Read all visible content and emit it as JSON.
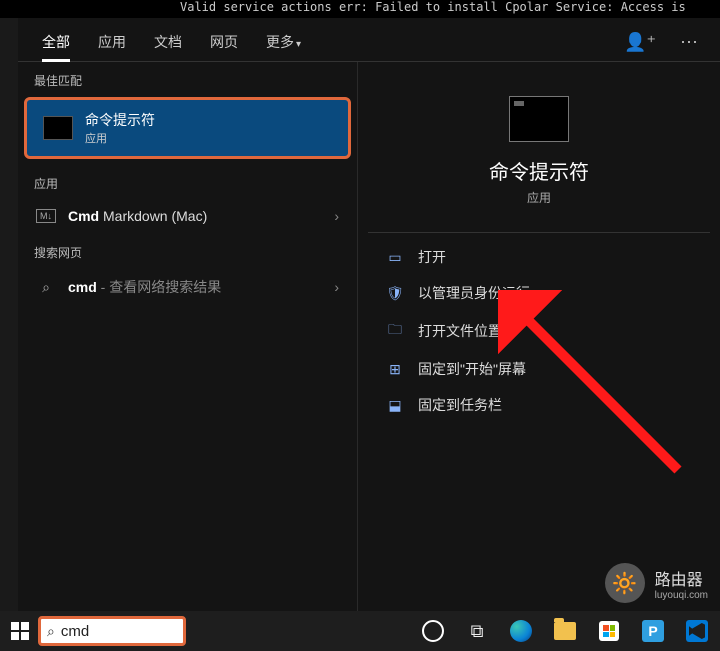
{
  "top_text": "Valid service actions err: Failed to install Cpolar Service: Access is ",
  "tabs": {
    "all": "全部",
    "apps": "应用",
    "docs": "文档",
    "web": "网页",
    "more": "更多"
  },
  "left": {
    "best_match_label": "最佳匹配",
    "best_match": {
      "title": "命令提示符",
      "sub": "应用"
    },
    "apps_label": "应用",
    "apps": [
      {
        "name_prefix": "Cmd",
        "name_rest": " Markdown (Mac)"
      }
    ],
    "web_label": "搜索网页",
    "web": [
      {
        "term": "cmd",
        "suffix": " - 查看网络搜索结果"
      }
    ]
  },
  "right": {
    "title": "命令提示符",
    "sub": "应用",
    "actions": {
      "open": "打开",
      "run_admin": "以管理员身份运行",
      "open_location": "打开文件位置",
      "pin_start": "固定到\"开始\"屏幕",
      "pin_taskbar": "固定到任务栏"
    }
  },
  "search": {
    "value": "cmd"
  },
  "watermark": {
    "title": "路由器",
    "sub": "luyouqi.com"
  }
}
